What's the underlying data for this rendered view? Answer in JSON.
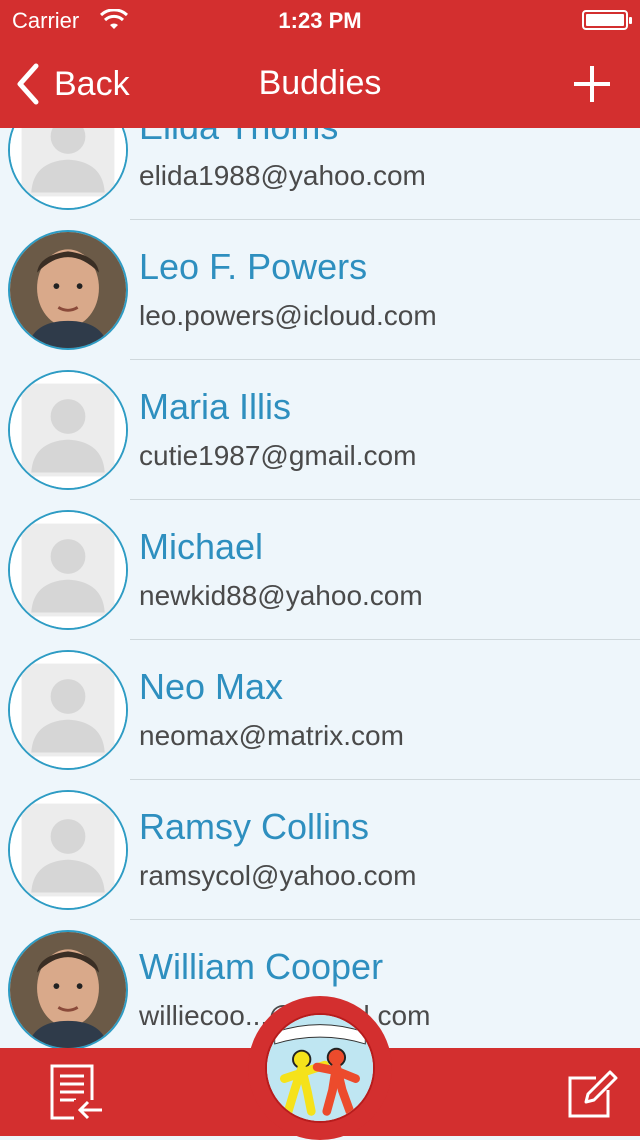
{
  "status": {
    "carrier": "Carrier",
    "time": "1:23 PM"
  },
  "nav": {
    "back_label": "Back",
    "title": "Buddies"
  },
  "contacts": [
    {
      "name": "Elida Thoms",
      "email": "elida1988@yahoo.com",
      "avatar": "placeholder"
    },
    {
      "name": "Leo F. Powers",
      "email": "leo.powers@icloud.com",
      "avatar": "photo"
    },
    {
      "name": "Maria Illis",
      "email": "cutie1987@gmail.com",
      "avatar": "placeholder"
    },
    {
      "name": "Michael",
      "email": "newkid88@yahoo.com",
      "avatar": "placeholder"
    },
    {
      "name": "Neo Max",
      "email": "neomax@matrix.com",
      "avatar": "placeholder"
    },
    {
      "name": "Ramsy Collins",
      "email": "ramsycol@yahoo.com",
      "avatar": "placeholder"
    },
    {
      "name": "William Cooper",
      "email": "williecoo...@icloud.com",
      "avatar": "photo"
    }
  ],
  "colors": {
    "brand_red": "#d32f2f",
    "accent_blue": "#2e8fbf",
    "background": "#eef6fb"
  },
  "icons": {
    "back": "chevron-left-icon",
    "add": "plus-icon",
    "tab_left": "import-list-icon",
    "tab_right": "compose-icon",
    "center": "buddies-logo"
  }
}
